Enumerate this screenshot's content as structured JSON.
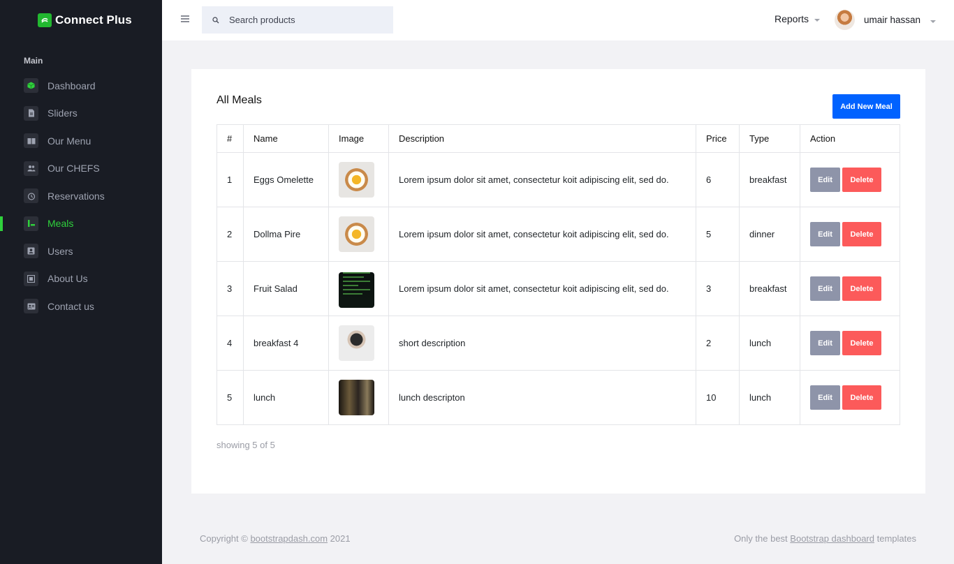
{
  "brand": {
    "name": "Connect Plus",
    "color": "#22b830"
  },
  "sidebar": {
    "category": "Main",
    "active_color": "#2fd13c",
    "items": [
      {
        "label": "Dashboard",
        "icon": "cube-icon",
        "active": false
      },
      {
        "label": "Sliders",
        "icon": "file-icon",
        "active": false
      },
      {
        "label": "Our Menu",
        "icon": "book-open-icon",
        "active": false
      },
      {
        "label": "Our CHEFS",
        "icon": "users-icon",
        "active": false
      },
      {
        "label": "Reservations",
        "icon": "alarm-clock-icon",
        "active": false
      },
      {
        "label": "Meals",
        "icon": "chart-icon",
        "active": true
      },
      {
        "label": "Users",
        "icon": "account-box-icon",
        "active": false
      },
      {
        "label": "About Us",
        "icon": "frame-icon",
        "active": false
      },
      {
        "label": "Contact us",
        "icon": "contact-card-icon",
        "active": false
      }
    ]
  },
  "topbar": {
    "search_placeholder": "Search products",
    "reports_label": "Reports",
    "user_name": "umair hassan"
  },
  "card": {
    "title": "All Meals",
    "add_button": "Add New Meal",
    "add_button_color": "#0062ff",
    "columns": [
      "#",
      "Name",
      "Image",
      "Description",
      "Price",
      "Type",
      "Action"
    ],
    "rows": [
      {
        "num": "1",
        "name": "Eggs Omelette",
        "image": "egg-toast-photo",
        "description": "Lorem ipsum dolor sit amet, consectetur koit adipiscing elit, sed do.",
        "price": "6",
        "type": "breakfast"
      },
      {
        "num": "2",
        "name": "Dollma Pire",
        "image": "egg-toast-photo",
        "description": "Lorem ipsum dolor sit amet, consectetur koit adipiscing elit, sed do.",
        "price": "5",
        "type": "dinner"
      },
      {
        "num": "3",
        "name": "Fruit Salad",
        "image": "code-screen-photo",
        "description": "Lorem ipsum dolor sit amet, consectetur koit adipiscing elit, sed do.",
        "price": "3",
        "type": "breakfast"
      },
      {
        "num": "4",
        "name": "breakfast 4",
        "image": "person-hat-photo",
        "description": "short description",
        "price": "2",
        "type": "lunch"
      },
      {
        "num": "5",
        "name": "lunch",
        "image": "restaurant-photo",
        "description": "lunch descripton",
        "price": "10",
        "type": "lunch"
      }
    ],
    "edit_label": "Edit",
    "delete_label": "Delete",
    "edit_color": "#8e94a9",
    "delete_color": "#fc5a5a",
    "showing": "showing 5 of 5"
  },
  "footer": {
    "copyright_prefix": "Copyright ©",
    "copyright_link": "bootstrapdash.com",
    "copyright_year": "2021",
    "right_prefix": "Only the best",
    "right_link": "Bootstrap dashboard",
    "right_suffix": "templates"
  }
}
